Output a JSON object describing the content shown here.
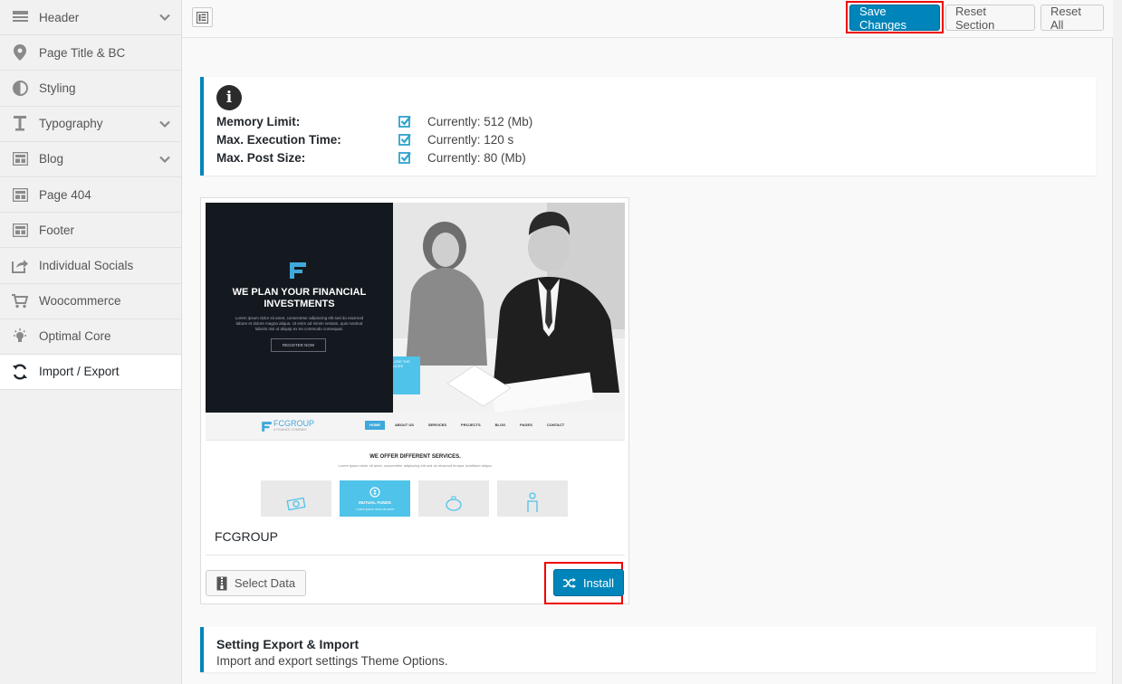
{
  "sidebar": {
    "items": [
      {
        "label": "Header",
        "icon": "header-icon",
        "has_chevron": true
      },
      {
        "label": "Page Title & BC",
        "icon": "map-pin-icon",
        "has_chevron": false
      },
      {
        "label": "Styling",
        "icon": "contrast-icon",
        "has_chevron": false
      },
      {
        "label": "Typography",
        "icon": "text-icon",
        "has_chevron": true
      },
      {
        "label": "Blog",
        "icon": "layout-icon",
        "has_chevron": true
      },
      {
        "label": "Page 404",
        "icon": "layout-icon",
        "has_chevron": false
      },
      {
        "label": "Footer",
        "icon": "layout-icon",
        "has_chevron": false
      },
      {
        "label": "Individual Socials",
        "icon": "share-icon",
        "has_chevron": false
      },
      {
        "label": "Woocommerce",
        "icon": "cart-icon",
        "has_chevron": false
      },
      {
        "label": "Optimal Core",
        "icon": "lightbulb-icon",
        "has_chevron": false
      },
      {
        "label": "Import / Export",
        "icon": "refresh-icon",
        "has_chevron": false,
        "active": true
      }
    ]
  },
  "toolbar": {
    "save_label": "Save Changes",
    "reset_section_label": "Reset Section",
    "reset_all_label": "Reset All"
  },
  "info": {
    "rows": [
      {
        "label": "Memory Limit:",
        "value": "Currently: 512 (Mb)"
      },
      {
        "label": "Max. Execution Time:",
        "value": "Currently: 120 s"
      },
      {
        "label": "Max. Post Size:",
        "value": "Currently: 80 (Mb)"
      }
    ]
  },
  "demo": {
    "name": "FCGROUP",
    "select_label": "Select Data",
    "install_label": "Install",
    "preview": {
      "headline_line1": "WE PLAN YOUR FINANCIAL",
      "headline_line2": "INVESTMENTS",
      "body_line1": "Lorem ipsum dolor sit amet, consectetur adipiscing elit sed do eiusmod",
      "body_line2": "labore et dolore magna aliqua. Ut enim ad minim veniam, quis nostrud",
      "body_line3": "laboris nisi ut aliquip ex ea commodo consequat.",
      "register": "REGISTER NOW",
      "explore": "EXPLORE THE SERVICES",
      "logo_text": "FCGROUP",
      "logo_sub": "A FINANCE COMPANY",
      "nav": [
        "HOME",
        "ABOUT US",
        "SERVICES",
        "PROJECTS",
        "BLOG",
        "PAGES",
        "CONTACT"
      ],
      "services_title": "WE OFFER DIFFERENT SERVICES.",
      "services_sub": "Lorem ipsum dolor sit amet, consectetur adipiscing elit sed do eiusmod tempor incididunt aliqua.",
      "featured": "MUTUAL FUNDS",
      "featured_sub": "Lorem ipsum dolor sit amet"
    }
  },
  "export": {
    "title": "Setting Export & Import",
    "description": "Import and export settings Theme Options."
  },
  "colors": {
    "accent": "#0085ba",
    "highlight": "#e00000"
  }
}
